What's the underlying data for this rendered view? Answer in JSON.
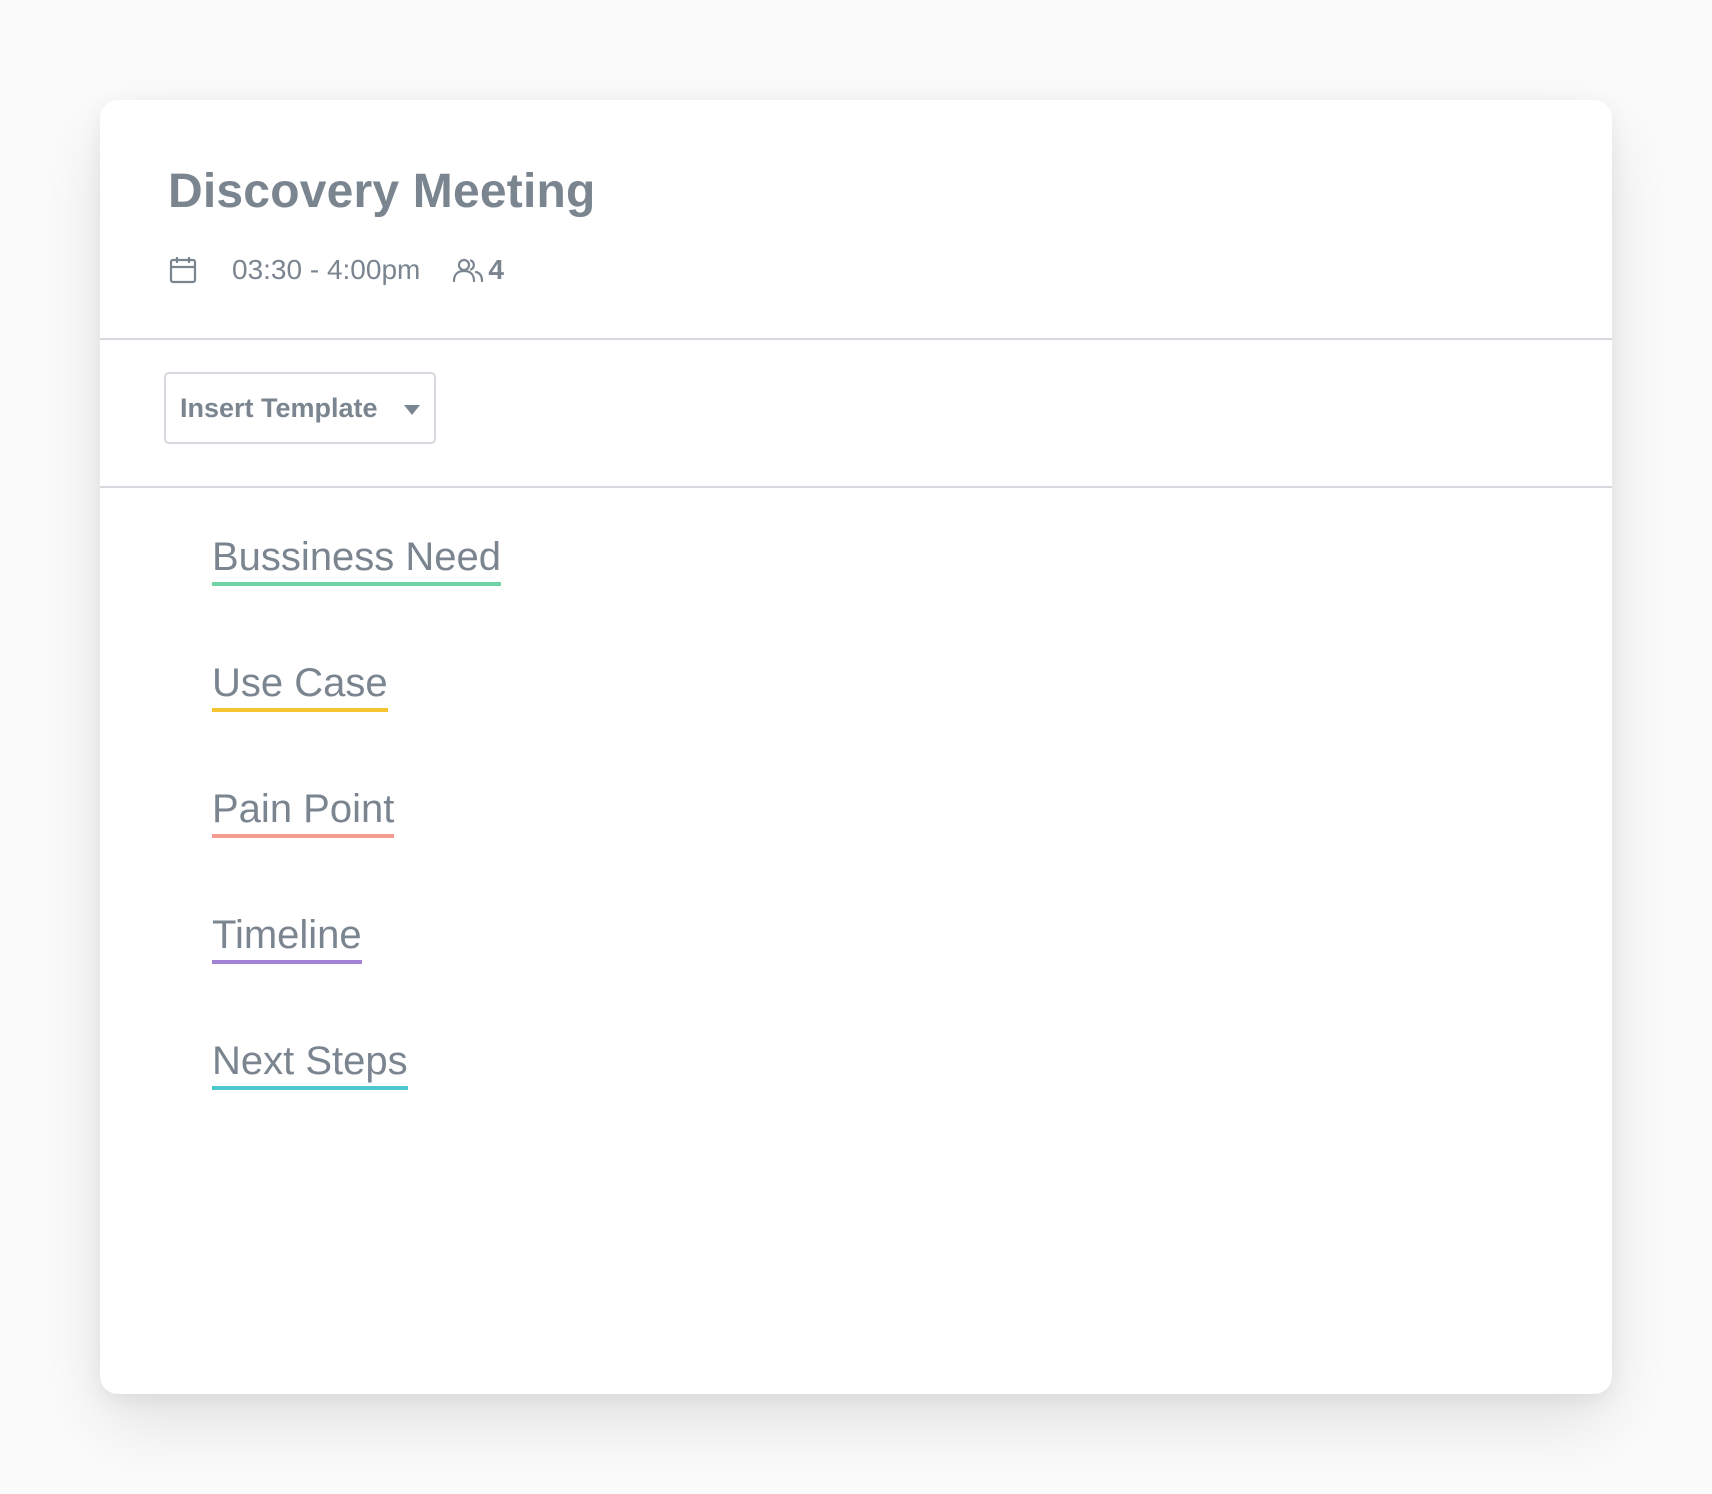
{
  "meeting": {
    "title": "Discovery Meeting",
    "time": "03:30 - 4:00pm",
    "attendee_count": "4",
    "icons": {
      "calendar": "calendar-icon",
      "attendees": "people-icon"
    }
  },
  "toolbar": {
    "template_select_label": "Insert Template",
    "template_select_icon": "chevron-down-icon"
  },
  "sections": [
    {
      "label": "Bussiness Need",
      "accent": "#6fd3a6"
    },
    {
      "label": "Use Case",
      "accent": "#f7c531"
    },
    {
      "label": "Pain Point",
      "accent": "#f59c92"
    },
    {
      "label": "Timeline",
      "accent": "#a384d4"
    },
    {
      "label": "Next Steps",
      "accent": "#4dc6cc"
    }
  ],
  "colors": {
    "text": "#7b8590",
    "divider": "#d6d9de",
    "card_background": "#ffffff"
  }
}
